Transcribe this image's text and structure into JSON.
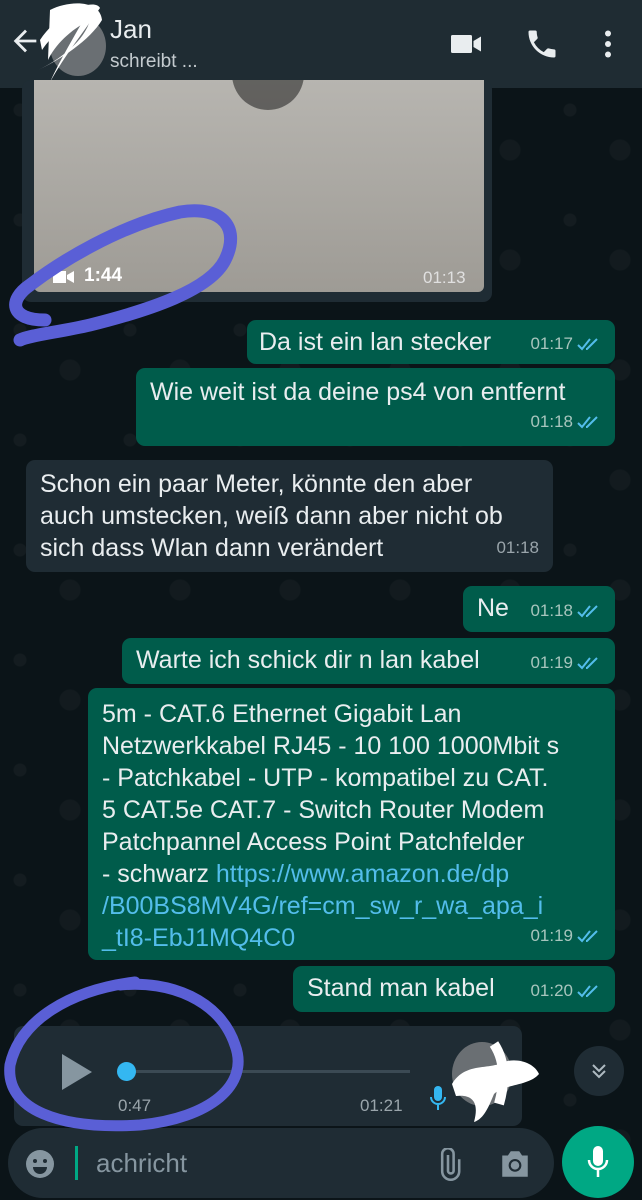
{
  "header": {
    "contact_name": "Jan",
    "status": "schreibt ..."
  },
  "icons": {
    "back": "arrow-left-icon",
    "video_call": "video-camera-icon",
    "voice_call": "phone-icon",
    "menu": "more-vert-icon"
  },
  "messages": [
    {
      "id": "video",
      "direction": "in",
      "type": "video",
      "duration": "1:44",
      "time": "01:13"
    },
    {
      "id": "m1",
      "direction": "out",
      "text": "Da ist ein lan stecker",
      "time": "01:17",
      "status": "read"
    },
    {
      "id": "m2",
      "direction": "out",
      "text": "Wie weit ist da deine ps4 von entfernt",
      "time": "01:18",
      "status": "read"
    },
    {
      "id": "m3",
      "direction": "in",
      "lines": [
        "Schon ein paar Meter, könnte den aber",
        "auch umstecken, weiß dann aber nicht ob",
        "sich dass Wlan dann verändert"
      ],
      "time": "01:18"
    },
    {
      "id": "m4",
      "direction": "out",
      "text": "Ne",
      "time": "01:18",
      "status": "read"
    },
    {
      "id": "m5",
      "direction": "out",
      "text": "Warte ich schick dir n lan kabel",
      "time": "01:19",
      "status": "read"
    },
    {
      "id": "m6",
      "direction": "out",
      "lines": [
        "5m - CAT.6 Ethernet Gigabit Lan",
        "Netzwerkkabel RJ45 - 10 100 1000Mbit s",
        "- Patchkabel - UTP - kompatibel zu CAT.",
        "5 CAT.5e CAT.7 - Switch Router Modem",
        "Patchpannel Access Point Patchfelder"
      ],
      "line6_prefix": "- schwarz ",
      "link_lines": [
        "https://www.amazon.de/dp",
        "/B00BS8MV4G/ref=cm_sw_r_wa_apa_i",
        "_tI8-EbJ1MQ4C0"
      ],
      "time": "01:19",
      "status": "read"
    },
    {
      "id": "m7",
      "direction": "out",
      "text": "Stand man kabel",
      "time": "01:20",
      "status": "read"
    },
    {
      "id": "voice",
      "direction": "in",
      "type": "voice",
      "elapsed": "0:47",
      "time": "01:21",
      "progress": 0.0
    }
  ],
  "composer": {
    "placeholder": "Nachricht",
    "visible_text": "achricht"
  },
  "colors": {
    "outgoing": "#005c4b",
    "incoming": "#1f2c34",
    "accent": "#00a884",
    "read_ticks": "#53bdeb",
    "annotation": "#5a5fd6"
  }
}
